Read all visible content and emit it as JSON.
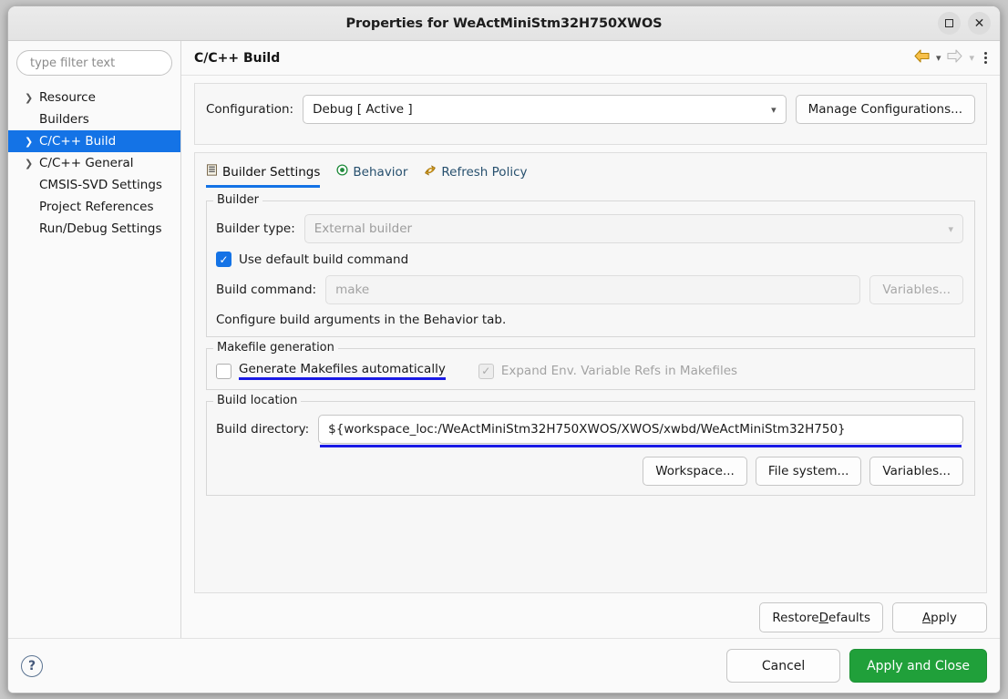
{
  "window": {
    "title": "Properties for WeActMiniStm32H750XWOS",
    "controls": {
      "maximize": "maximize-icon",
      "close": "close-icon"
    }
  },
  "sidebar": {
    "filter": {
      "placeholder": "type filter text",
      "value": ""
    },
    "items": [
      {
        "label": "Resource",
        "expandable": true,
        "selected": false
      },
      {
        "label": "Builders",
        "expandable": false,
        "selected": false
      },
      {
        "label": "C/C++ Build",
        "expandable": true,
        "selected": true
      },
      {
        "label": "C/C++ General",
        "expandable": true,
        "selected": false
      },
      {
        "label": "CMSIS-SVD Settings",
        "expandable": false,
        "selected": false
      },
      {
        "label": "Project References",
        "expandable": false,
        "selected": false
      },
      {
        "label": "Run/Debug Settings",
        "expandable": false,
        "selected": false
      }
    ]
  },
  "pane": {
    "title": "C/C++ Build",
    "nav": {
      "back_icon": "back-arrow-icon",
      "back_menu_icon": "chevron-down-icon",
      "forward_icon": "forward-arrow-icon",
      "forward_menu_icon": "chevron-down-icon",
      "menu_icon": "kebab-menu-icon"
    }
  },
  "configuration": {
    "label": "Configuration:",
    "value": "Debug  [ Active ]",
    "manage_button": "Manage Configurations..."
  },
  "tabs": [
    {
      "label": "Builder Settings",
      "icon": "document-lines-icon",
      "active": true
    },
    {
      "label": "Behavior",
      "icon": "target-circle-icon",
      "active": false
    },
    {
      "label": "Refresh Policy",
      "icon": "refresh-arrows-icon",
      "active": false
    }
  ],
  "builder_group": {
    "legend": "Builder",
    "builder_type_label": "Builder type:",
    "builder_type_value": "External builder",
    "use_default_build_command": {
      "label": "Use default build command",
      "checked": true
    },
    "build_command_label": "Build command:",
    "build_command_value": "make",
    "variables_button": "Variables...",
    "hint": "Configure build arguments in the Behavior tab."
  },
  "makefile_group": {
    "legend": "Makefile generation",
    "generate_makefiles": {
      "label": "Generate Makefiles automatically",
      "checked": false,
      "highlighted": true
    },
    "expand_env_refs": {
      "label": "Expand Env. Variable Refs in Makefiles",
      "checked": true,
      "disabled": true
    }
  },
  "build_location_group": {
    "legend": "Build location",
    "build_directory_label": "Build directory:",
    "build_directory_value": "${workspace_loc:/WeActMiniStm32H750XWOS/XWOS/xwbd/WeActMiniStm32H750}",
    "highlighted": true,
    "buttons": [
      "Workspace...",
      "File system...",
      "Variables..."
    ]
  },
  "page_buttons": {
    "restore_defaults": {
      "text": "Restore Defaults",
      "mnemonic": "D"
    },
    "apply": {
      "text": "Apply",
      "mnemonic": "A"
    }
  },
  "footer": {
    "help_icon": "help-question-icon",
    "cancel": "Cancel",
    "apply_and_close": "Apply and Close"
  },
  "colors": {
    "selection_blue": "#1473e6",
    "annotation_blue": "#1a1ae6",
    "primary_green": "#20a03a",
    "tab_link": "#27506e"
  }
}
